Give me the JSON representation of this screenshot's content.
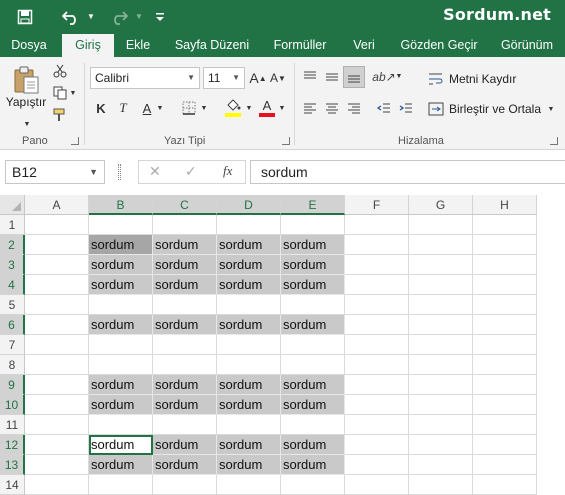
{
  "brand": "Sordum.net",
  "quick_access": {
    "save": "save-icon",
    "undo": "undo-icon",
    "redo": "redo-icon",
    "customize": "customize-qat-icon"
  },
  "tabs": [
    "Dosya",
    "Giriş",
    "Ekle",
    "Sayfa Düzeni",
    "Formüller",
    "Veri",
    "Gözden Geçir",
    "Görünüm"
  ],
  "active_tab": "Giriş",
  "ribbon": {
    "paste_label": "Yapıştır",
    "clipboard_label": "Pano",
    "font_name": "Calibri",
    "font_size": "11",
    "grow_font": "A",
    "shrink_font": "A",
    "bold": "K",
    "italic": "T",
    "underline": "A",
    "font_color_letter": "A",
    "font_group_label": "Yazı Tipi",
    "wrap_text": "Metni Kaydır",
    "merge_center": "Birleştir ve Ortala",
    "alignment_label": "Hizalama",
    "colors": {
      "fill": "#ffff00",
      "font": "#e81123",
      "accent": "#217346"
    }
  },
  "formula_bar": {
    "name_box": "B12",
    "formula": "sordum",
    "fx": "fx",
    "cancel": "✕",
    "enter": "✓"
  },
  "grid": {
    "columns": [
      "A",
      "B",
      "C",
      "D",
      "E",
      "F",
      "G",
      "H"
    ],
    "rows": [
      "1",
      "2",
      "3",
      "4",
      "5",
      "6",
      "7",
      "8",
      "9",
      "10",
      "11",
      "12",
      "13",
      "14"
    ],
    "cell_text": "sordum",
    "filled_rows": [
      "2",
      "3",
      "4",
      "6",
      "9",
      "10",
      "12",
      "13"
    ],
    "filled_columns": [
      "B",
      "C",
      "D",
      "E"
    ],
    "active_cell": "B12",
    "darker_cell": "B2"
  }
}
